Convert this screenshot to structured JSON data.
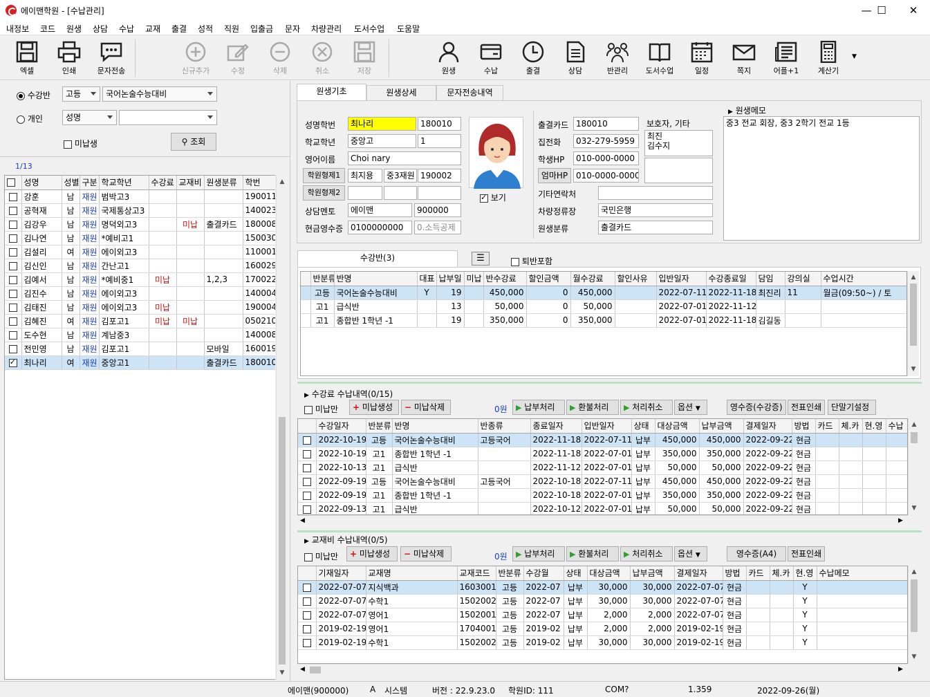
{
  "window": {
    "title": "에이맨학원 - [수납관리]"
  },
  "menu": [
    "내정보",
    "코드",
    "원생",
    "상담",
    "수납",
    "교재",
    "출결",
    "성적",
    "직원",
    "입출금",
    "문자",
    "차량관리",
    "도서수업",
    "도움말"
  ],
  "toolbar": {
    "left": [
      {
        "label": "엑셀",
        "icon": "save-icon"
      },
      {
        "label": "인쇄",
        "icon": "printer-icon"
      },
      {
        "label": "문자전송",
        "icon": "message-icon"
      }
    ],
    "mid": [
      {
        "label": "신규추가",
        "icon": "plus-circle-icon"
      },
      {
        "label": "수정",
        "icon": "pencil-icon"
      },
      {
        "label": "삭제",
        "icon": "minus-circle-icon"
      },
      {
        "label": "취소",
        "icon": "x-circle-icon"
      },
      {
        "label": "저장",
        "icon": "save-icon"
      }
    ],
    "right": [
      {
        "label": "원생",
        "icon": "person-icon"
      },
      {
        "label": "수납",
        "icon": "wallet-icon"
      },
      {
        "label": "출결",
        "icon": "clock-icon"
      },
      {
        "label": "상담",
        "icon": "document-icon"
      },
      {
        "label": "반관리",
        "icon": "group-icon"
      },
      {
        "label": "도서수업",
        "icon": "book-icon"
      },
      {
        "label": "일정",
        "icon": "calendar-icon"
      },
      {
        "label": "쪽지",
        "icon": "mail-icon"
      },
      {
        "label": "어플+1",
        "icon": "news-icon"
      },
      {
        "label": "계산기",
        "icon": "calculator-icon"
      }
    ]
  },
  "filter": {
    "mode_class": "수강반",
    "mode_person": "개인",
    "level": "고등",
    "class_name": "국어논술수능대비",
    "search_type": "성명",
    "search_value": "",
    "unpaid": "미납생",
    "search_btn": "조회",
    "count": "1/13"
  },
  "student_grid": {
    "headers": [
      "성명",
      "성별",
      "구분",
      "학교학년",
      "수강료",
      "교재비",
      "원생분류",
      "학번"
    ],
    "rows": [
      {
        "name": "강훈",
        "sex": "남",
        "type": "재원",
        "school": "범박고3",
        "fee": "",
        "book": "",
        "cls": "",
        "id": "190011",
        "checked": false
      },
      {
        "name": "공혁재",
        "sex": "남",
        "type": "재원",
        "school": "국제통상고3",
        "fee": "",
        "book": "",
        "cls": "",
        "id": "140023",
        "checked": false
      },
      {
        "name": "김강우",
        "sex": "남",
        "type": "재원",
        "school": "명덕외고3",
        "fee": "",
        "book": "미납",
        "cls": "출결카드",
        "id": "180008",
        "checked": false
      },
      {
        "name": "김나연",
        "sex": "남",
        "type": "재원",
        "school": "*예비고1",
        "fee": "",
        "book": "",
        "cls": "",
        "id": "150030",
        "checked": false
      },
      {
        "name": "김설리",
        "sex": "여",
        "type": "재원",
        "school": "에이외고3",
        "fee": "",
        "book": "",
        "cls": "",
        "id": "110001",
        "checked": false
      },
      {
        "name": "김신인",
        "sex": "남",
        "type": "재원",
        "school": "간난고1",
        "fee": "",
        "book": "",
        "cls": "",
        "id": "160029",
        "checked": false
      },
      {
        "name": "김예서",
        "sex": "남",
        "type": "재원",
        "school": "*예비중1",
        "fee": "미납",
        "book": "",
        "cls": "1,2,3",
        "id": "170022",
        "checked": false
      },
      {
        "name": "김진수",
        "sex": "남",
        "type": "재원",
        "school": "에이외고3",
        "fee": "",
        "book": "",
        "cls": "",
        "id": "140004",
        "checked": false
      },
      {
        "name": "김태진",
        "sex": "남",
        "type": "재원",
        "school": "에이외고3",
        "fee": "미납",
        "book": "",
        "cls": "",
        "id": "190004",
        "checked": false
      },
      {
        "name": "김혜진",
        "sex": "여",
        "type": "재원",
        "school": "김포고1",
        "fee": "미납",
        "book": "미납",
        "cls": "",
        "id": "050210",
        "checked": false
      },
      {
        "name": "도수현",
        "sex": "남",
        "type": "재원",
        "school": "계남중3",
        "fee": "",
        "book": "",
        "cls": "",
        "id": "140008",
        "checked": false
      },
      {
        "name": "전민영",
        "sex": "남",
        "type": "재원",
        "school": "김포고1",
        "fee": "",
        "book": "",
        "cls": "모바일",
        "id": "160019",
        "checked": false
      },
      {
        "name": "최나리",
        "sex": "여",
        "type": "재원",
        "school": "중앙고1",
        "fee": "",
        "book": "",
        "cls": "출결카드",
        "id": "180010",
        "checked": true
      }
    ]
  },
  "tabs": [
    "원생기초",
    "원생상세",
    "문자전송내역"
  ],
  "student": {
    "lbl_name": "성명학번",
    "name": "최나리",
    "id": "180010",
    "lbl_school": "학교학년",
    "school": "중앙고",
    "grade": "1",
    "lbl_eng": "영어이름",
    "eng": "Choi nary",
    "btn_sib1": "학원형제1",
    "sib1_name": "최지용",
    "sib1_grade": "중3재원",
    "sib1_id": "190002",
    "btn_sib2": "학원형제2",
    "lbl_mentor": "상담멘토",
    "mentor": "에이맨",
    "mentor_id": "900000",
    "lbl_receipt": "현금영수증",
    "receipt": "0100000000",
    "receipt_type": "0.소득공제",
    "photo_show": "보기",
    "lbl_card": "출결카드",
    "card": "180010",
    "lbl_home": "집전화",
    "home": "032-279-5959",
    "lbl_hp": "학생HP",
    "hp": "010-000-0000",
    "btn_mom": "엄마HP",
    "mom": "010-0000-0000",
    "lbl_guardian": "보호자, 기타",
    "guardian1": "최진",
    "guardian2": "김수지",
    "lbl_other": "기타연락처",
    "other": "",
    "lbl_bank": "차량정류장",
    "bank": "국민은행",
    "lbl_cls": "원생분류",
    "cls": "출결카드",
    "memo_title": "원생메모",
    "memo": "중3 전교 회장, 중3 2학기 전교 1등"
  },
  "class_section": {
    "tab": "수강반(3)",
    "retired": "퇴반포함",
    "headers": [
      "반분류",
      "반명",
      "대표",
      "납부일",
      "미납",
      "반수강료",
      "할인금액",
      "월수강료",
      "할인사유",
      "입반일자",
      "수강종료일",
      "담임",
      "강의실",
      "수업시간"
    ],
    "rows": [
      [
        "고등",
        "국어논술수능대비",
        "Y",
        "19",
        "",
        "450,000",
        "0",
        "450,000",
        "",
        "2022-07-11",
        "2022-11-18",
        "최진리",
        "11",
        "월금(09:50~) / 토"
      ],
      [
        "고1",
        "급식반",
        "",
        "13",
        "",
        "50,000",
        "0",
        "50,000",
        "",
        "2022-07-01",
        "2022-11-12",
        "",
        "",
        ""
      ],
      [
        "고1",
        "종합반 1학년 -1",
        "",
        "19",
        "",
        "350,000",
        "0",
        "350,000",
        "",
        "2022-07-01",
        "2022-11-18",
        "김길동",
        "",
        ""
      ]
    ]
  },
  "fee_section": {
    "title": "수강료 수납내역(0/15)",
    "unpaid": "미납만",
    "btn_gen": "미납생성",
    "btn_del": "미납삭제",
    "amount": "0원",
    "btn_pay": "납부처리",
    "btn_refund": "환불처리",
    "btn_cancel": "처리취소",
    "btn_opt": "옵션",
    "btn_receipt": "영수증(수강증)",
    "btn_slip": "전표인쇄",
    "btn_term": "단말기설정",
    "headers": [
      "수강일자",
      "반분류",
      "반명",
      "반종류",
      "종료일자",
      "입반일자",
      "상태",
      "대상금액",
      "납부금액",
      "결제일자",
      "방법",
      "카드",
      "체.카",
      "현.영",
      "수납"
    ],
    "rows": [
      [
        "2022-10-19",
        "고등",
        "국어논술수능대비",
        "고등국어",
        "2022-11-18",
        "2022-07-11",
        "납부",
        "450,000",
        "450,000",
        "2022-09-22",
        "현금",
        "",
        "",
        "",
        ""
      ],
      [
        "2022-10-19",
        "고1",
        "종합반 1학년 -1",
        "",
        "2022-11-18",
        "2022-07-01",
        "납부",
        "350,000",
        "350,000",
        "2022-09-22",
        "현금",
        "",
        "",
        "",
        ""
      ],
      [
        "2022-10-13",
        "고1",
        "급식반",
        "",
        "2022-11-12",
        "2022-07-01",
        "납부",
        "50,000",
        "50,000",
        "2022-09-22",
        "현금",
        "",
        "",
        "",
        ""
      ],
      [
        "2022-09-19",
        "고등",
        "국어논술수능대비",
        "고등국어",
        "2022-10-18",
        "2022-07-11",
        "납부",
        "450,000",
        "450,000",
        "2022-09-22",
        "현금",
        "",
        "",
        "",
        ""
      ],
      [
        "2022-09-19",
        "고1",
        "종합반 1학년 -1",
        "",
        "2022-10-18",
        "2022-07-01",
        "납부",
        "350,000",
        "350,000",
        "2022-09-22",
        "현금",
        "",
        "",
        "",
        ""
      ],
      [
        "2022-09-13",
        "고1",
        "급식반",
        "",
        "2022-10-12",
        "2022-07-01",
        "납부",
        "50,000",
        "50,000",
        "2022-09-22",
        "현금",
        "",
        "",
        "",
        ""
      ]
    ]
  },
  "book_section": {
    "title": "교재비 수납내역(0/5)",
    "unpaid": "미납만",
    "btn_gen": "미납생성",
    "btn_del": "미납삭제",
    "amount": "0원",
    "btn_pay": "납부처리",
    "btn_refund": "환불처리",
    "btn_cancel": "처리취소",
    "btn_opt": "옵션",
    "btn_receipt": "영수증(A4)",
    "btn_slip": "전표인쇄",
    "headers": [
      "기재일자",
      "교재명",
      "교재코드",
      "반분류",
      "수강월",
      "상태",
      "대상금액",
      "납부금액",
      "결제일자",
      "방법",
      "카드",
      "체.카",
      "현.영",
      "수납메모"
    ],
    "rows": [
      [
        "2022-07-07",
        "지식백과",
        "1603001",
        "고등",
        "2022-07",
        "납부",
        "30,000",
        "30,000",
        "2022-07-07",
        "현금",
        "",
        "",
        "Y",
        ""
      ],
      [
        "2022-07-07",
        "수학1",
        "1502002",
        "고등",
        "2022-07",
        "납부",
        "30,000",
        "30,000",
        "2022-07-07",
        "현금",
        "",
        "",
        "Y",
        ""
      ],
      [
        "2022-07-07",
        "영어1",
        "1502001",
        "고등",
        "2022-07",
        "납부",
        "2,000",
        "2,000",
        "2022-07-07",
        "현금",
        "",
        "",
        "Y",
        ""
      ],
      [
        "2019-02-19",
        "영어1",
        "1704001",
        "고등",
        "2019-02",
        "납부",
        "2,000",
        "2,000",
        "2019-02-19",
        "현금",
        "",
        "",
        "Y",
        ""
      ],
      [
        "2019-02-19",
        "수학1",
        "1502002",
        "고등",
        "2019-02",
        "납부",
        "30,000",
        "30,000",
        "2019-02-19",
        "현금",
        "",
        "",
        "Y",
        ""
      ]
    ]
  },
  "status": {
    "user": "에이맨(900000)",
    "mode": "A",
    "sys": "시스템",
    "version": "버전 : 22.9.23.0",
    "academy": "학원ID: 111",
    "com": "COM?",
    "scale": "1.359",
    "date": "2022-09-26(월)"
  },
  "colors": {
    "name_highlight": "#ffff00",
    "selected_row": "#cde4f7",
    "link_blue": "#1a3ec8",
    "unpaid_red": "#d01010"
  }
}
